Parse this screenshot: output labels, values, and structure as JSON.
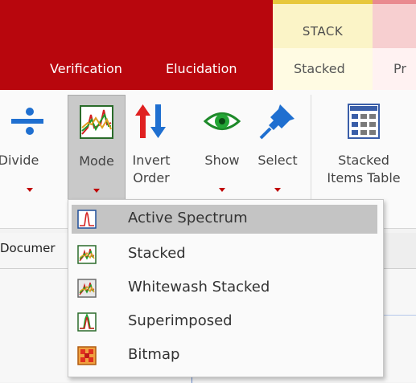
{
  "context_tab": {
    "label": "STACK",
    "colors": {
      "band": "#b8060d",
      "context_bg": "#fbf4c7",
      "context_border": "#e7c73c"
    }
  },
  "tabs": [
    {
      "label": "Verification",
      "active": false
    },
    {
      "label": "Elucidation",
      "active": false
    },
    {
      "label": "Stacked",
      "active": true
    },
    {
      "label": "Pr",
      "active": false
    }
  ],
  "ribbon": {
    "buttons": [
      {
        "label": "Divide",
        "icon": "divide-icon",
        "has_dropdown": true
      },
      {
        "label": "Mode",
        "icon": "stacked-mode-icon",
        "has_dropdown": true,
        "pressed": true
      },
      {
        "label_line1": "Invert",
        "label_line2": "Order",
        "icon": "invert-order-icon",
        "has_dropdown": false
      },
      {
        "label": "Show",
        "icon": "eye-icon",
        "has_dropdown": true
      },
      {
        "label": "Select",
        "icon": "pushpin-icon",
        "has_dropdown": true
      },
      {
        "label_line1": "Stacked",
        "label_line2": "Items Table",
        "icon": "items-table-icon",
        "has_dropdown": false
      }
    ]
  },
  "document_tab": {
    "label": "Documer"
  },
  "mode_menu": {
    "items": [
      {
        "label": "Active Spectrum",
        "icon": "active-spectrum-icon",
        "highlighted": true
      },
      {
        "label": "Stacked",
        "icon": "stacked-icon",
        "highlighted": false
      },
      {
        "label": "Whitewash Stacked",
        "icon": "whitewash-stacked-icon",
        "highlighted": false
      },
      {
        "label": "Superimposed",
        "icon": "superimposed-icon",
        "highlighted": false
      },
      {
        "label": "Bitmap",
        "icon": "bitmap-icon",
        "highlighted": false
      }
    ]
  }
}
